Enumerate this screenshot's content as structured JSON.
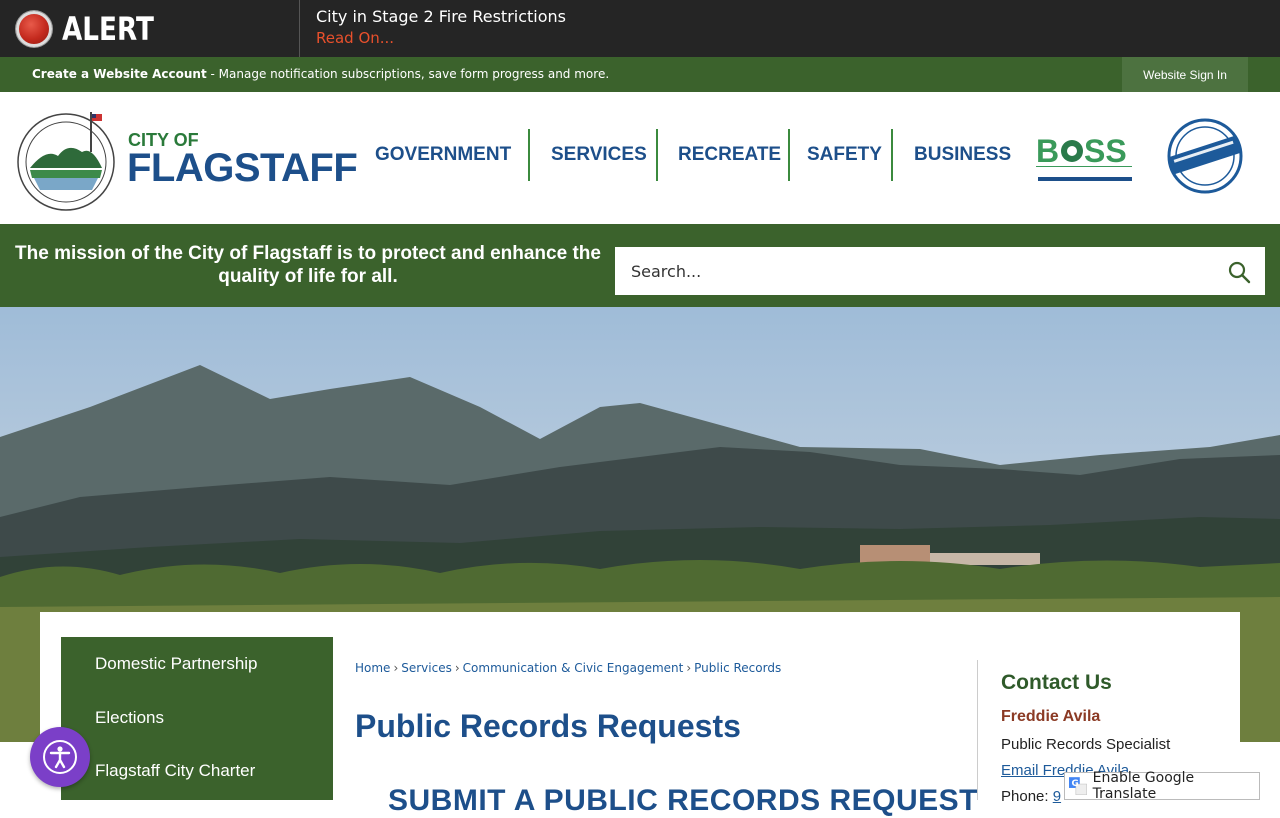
{
  "alert": {
    "label": "ALERT",
    "title": "City in Stage 2 Fire Restrictions",
    "link": "Read On..."
  },
  "account": {
    "create_label": "Create a Website Account",
    "description": " - Manage notification subscriptions, save form progress and more.",
    "signin_label": "Website Sign In"
  },
  "header": {
    "city_of": "CITY OF",
    "flagstaff": "FLAGSTAFF",
    "nav": [
      "GOVERNMENT",
      "SERVICES",
      "RECREATE",
      "SAFETY",
      "BUSINESS"
    ]
  },
  "mission": {
    "text": "The mission of the City of Flagstaff is to protect and enhance the quality of life for all.",
    "search_placeholder": "Search..."
  },
  "sidenav": {
    "items": [
      "Domestic Partnership",
      "Elections",
      "Flagstaff City Charter"
    ]
  },
  "breadcrumb": [
    "Home",
    "Services",
    "Communication & Civic Engagement",
    "Public Records"
  ],
  "page": {
    "title": "Public Records Requests",
    "submit_heading": "SUBMIT A PUBLIC RECORDS REQUEST"
  },
  "contact": {
    "title": "Contact Us",
    "name": "Freddie Avila",
    "role": "Public Records Specialist",
    "email_label": "Email Freddie Avila",
    "phone_label": "Phone: ",
    "phone_value": "9"
  },
  "translate": {
    "label": "Enable Google Translate"
  },
  "colors": {
    "brand_green": "#3b622c",
    "brand_blue": "#1d4f8a",
    "alert_red": "#e8502c"
  }
}
